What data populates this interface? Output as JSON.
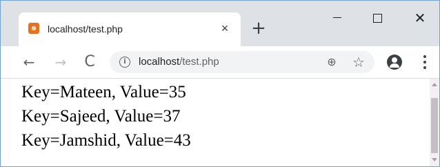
{
  "tab": {
    "title": "localhost/test.php",
    "favicon": "xampp-favicon-icon",
    "close_glyph": "×"
  },
  "new_tab_glyph": "+",
  "window_controls": {
    "close_glyph": "✕"
  },
  "toolbar": {
    "back_glyph": "←",
    "forward_glyph": "→",
    "reload_glyph": "C",
    "info_glyph": "i",
    "url_host": "localhost",
    "url_path": "/test.php",
    "zoom_glyph": "⊕",
    "star_glyph": "☆"
  },
  "content": {
    "lines": [
      "Key=Mateen, Value=35",
      "Key=Sajeed, Value=37",
      "Key=Jamshid, Value=43"
    ]
  },
  "colors": {
    "tabstrip": "#dee1e6",
    "omnibox": "#f1f3f4",
    "favicon": "#e8711c"
  }
}
